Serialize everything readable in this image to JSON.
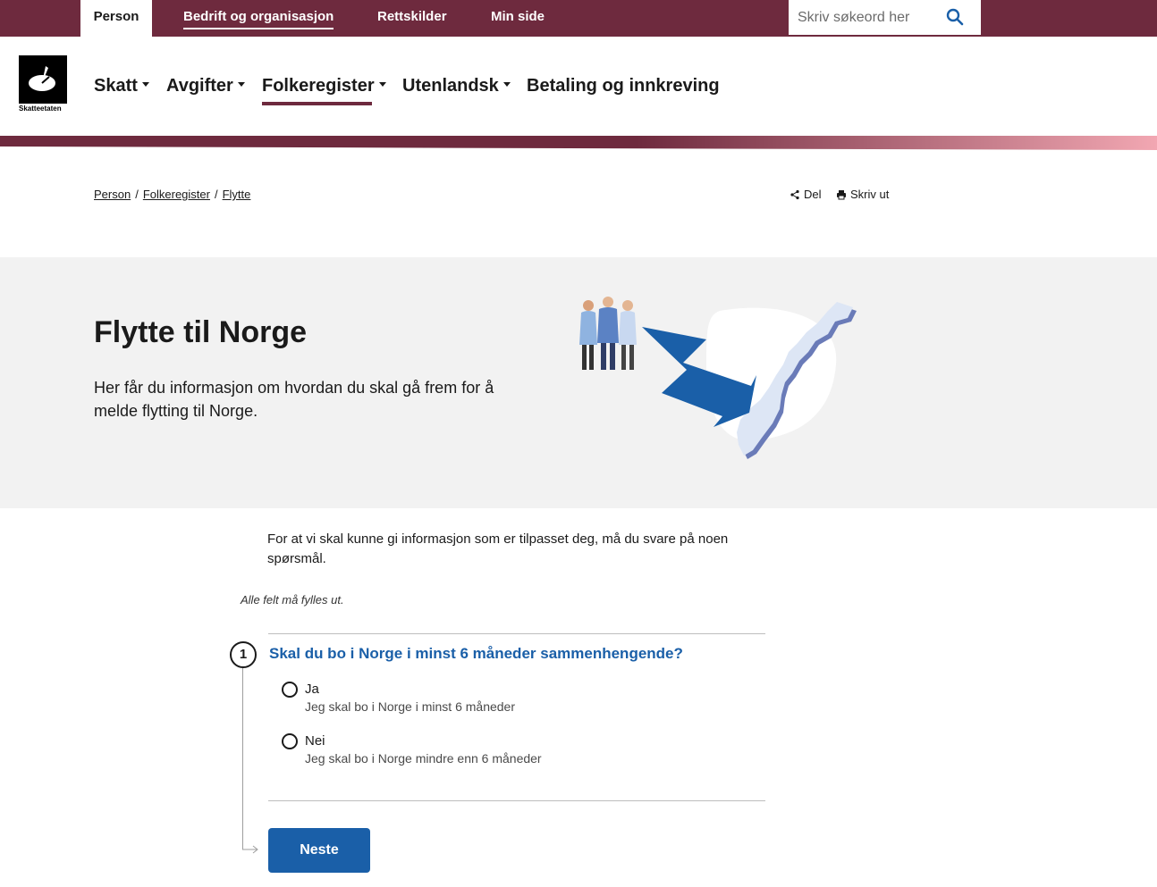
{
  "topbar": {
    "tabs": [
      "Person",
      "Bedrift og organisasjon",
      "Rettskilder",
      "Min side"
    ],
    "search_placeholder": "Skriv søkeord her"
  },
  "header": {
    "logo_text": "Skatteetaten",
    "nav": [
      "Skatt",
      "Avgifter",
      "Folkeregister",
      "Utenlandsk",
      "Betaling og innkreving"
    ]
  },
  "breadcrumb": [
    "Person",
    "Folkeregister",
    "Flytte"
  ],
  "actions": {
    "share": "Del",
    "print": "Skriv ut"
  },
  "hero": {
    "title": "Flytte til Norge",
    "lead": "Her får du informasjon om hvordan du skal gå frem for å melde flytting til Norge."
  },
  "form": {
    "intro": "For at vi skal kunne gi informasjon som er tilpasset deg, må du svare på noen spørsmål.",
    "required_note": "Alle felt må fylles ut.",
    "step_number": "1",
    "question": "Skal du bo i Norge i minst 6 måneder sammenhengende?",
    "options": [
      {
        "label": "Ja",
        "description": "Jeg skal bo i Norge i minst 6 måneder"
      },
      {
        "label": "Nei",
        "description": "Jeg skal bo i Norge mindre enn 6 måneder"
      }
    ],
    "next_button": "Neste"
  },
  "colors": {
    "brand": "#6e2a3e",
    "primary": "#1a5fa8",
    "hero_bg": "#f2f2f2"
  }
}
